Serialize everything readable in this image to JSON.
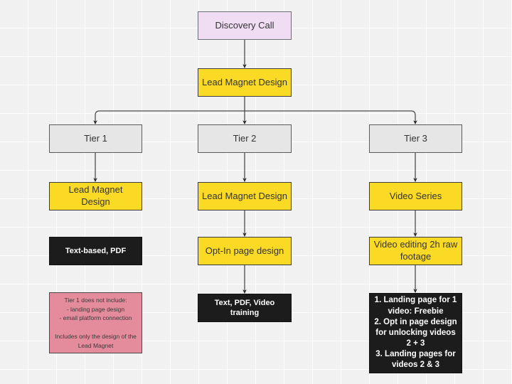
{
  "diagram": {
    "title": "Lead Magnet Tier Flowchart",
    "background_color": "#f1f1f1",
    "grid_size": 40,
    "colors": {
      "start": "#f0ddf4",
      "tier": "#e6e6e6",
      "highlight": "#fada24",
      "deliverable": "#1c1c1c",
      "note": "#e48c9c",
      "edge": "#4d4d4d"
    }
  },
  "nodes": {
    "discovery_call": {
      "label": "Discovery Call"
    },
    "lead_magnet_design_top": {
      "label": "Lead Magnet Design"
    },
    "tier1": {
      "label": "Tier 1"
    },
    "tier2": {
      "label": "Tier 2"
    },
    "tier3": {
      "label": "Tier 3"
    },
    "tier1_lead_magnet_design": {
      "label": "Lead Magnet Design"
    },
    "tier2_lead_magnet_design": {
      "label": "Lead Magnet Design"
    },
    "tier3_video_series": {
      "label": "Video Series"
    },
    "tier1_deliverable": {
      "label": "Text-based, PDF"
    },
    "tier2_optin": {
      "label": "Opt-In page design"
    },
    "tier3_video_editing": {
      "label": "Video editing 2h raw footage"
    },
    "tier2_deliverable": {
      "label": "Text, PDF, Video training"
    },
    "tier1_note": {
      "label": "Tier 1 does not include:\n- landing page design\n- email platform connection\n\nIncludes only the design of the Lead Magnet"
    },
    "tier3_deliverable": {
      "label": "1. Landing page for 1 video: Freebie\n2. Opt in page design for unlocking videos 2 + 3\n3. Landing pages for videos 2 & 3"
    }
  }
}
